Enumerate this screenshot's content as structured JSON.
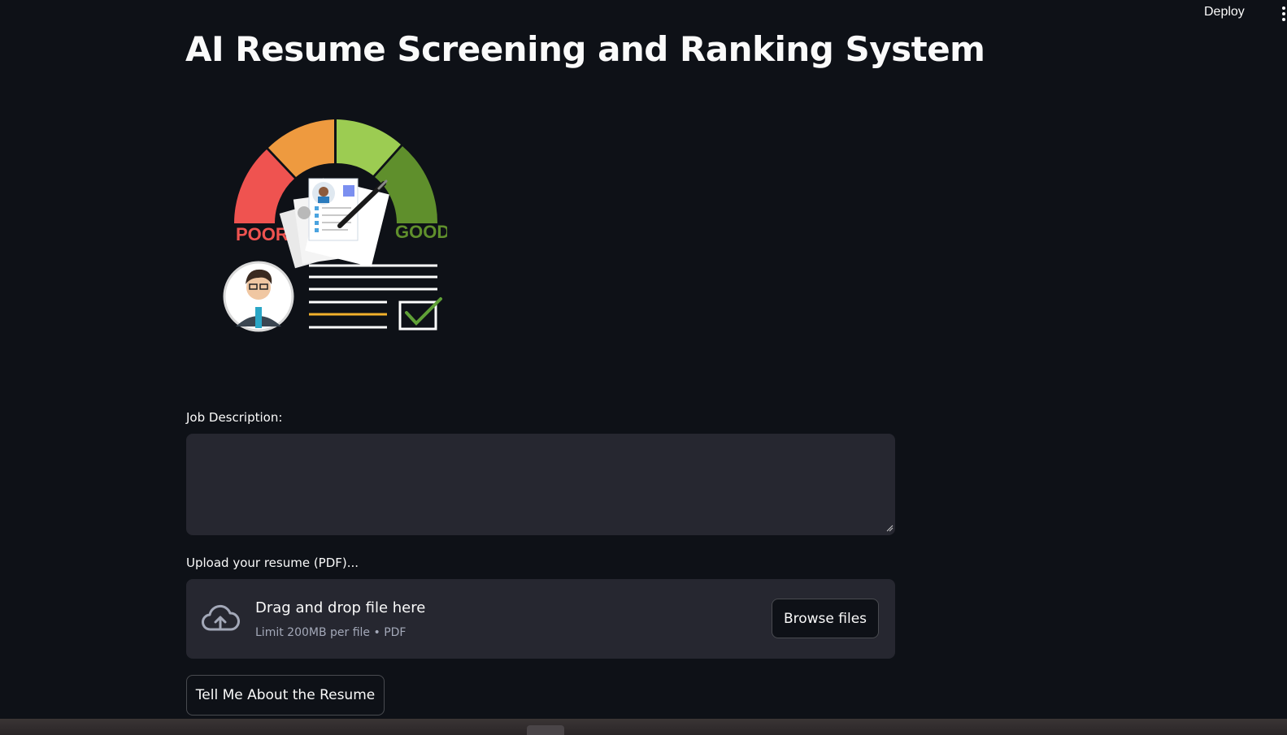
{
  "header": {
    "deploy_label": "Deploy",
    "menu_icon": "kebab-menu-icon"
  },
  "page": {
    "title": "AI Resume Screening and Ranking System"
  },
  "hero_image": {
    "gauge_left_label": "POOR",
    "gauge_right_label": "GOOD",
    "colors": {
      "poor": "#ef5350",
      "fair": "#ee9a3f",
      "ok": "#9ccc52",
      "good": "#5f8f2c"
    }
  },
  "job_description": {
    "label": "Job Description:",
    "value": ""
  },
  "uploader": {
    "label": "Upload your resume (PDF)...",
    "icon": "cloud-upload-icon",
    "drag_text": "Drag and drop file here",
    "limit_text": "Limit 200MB per file • PDF",
    "browse_label": "Browse files"
  },
  "actions": {
    "tell_me_label": "Tell Me About the Resume"
  },
  "theme": {
    "background": "#0e1117",
    "input_background": "#262730",
    "text": "#fafafa"
  }
}
